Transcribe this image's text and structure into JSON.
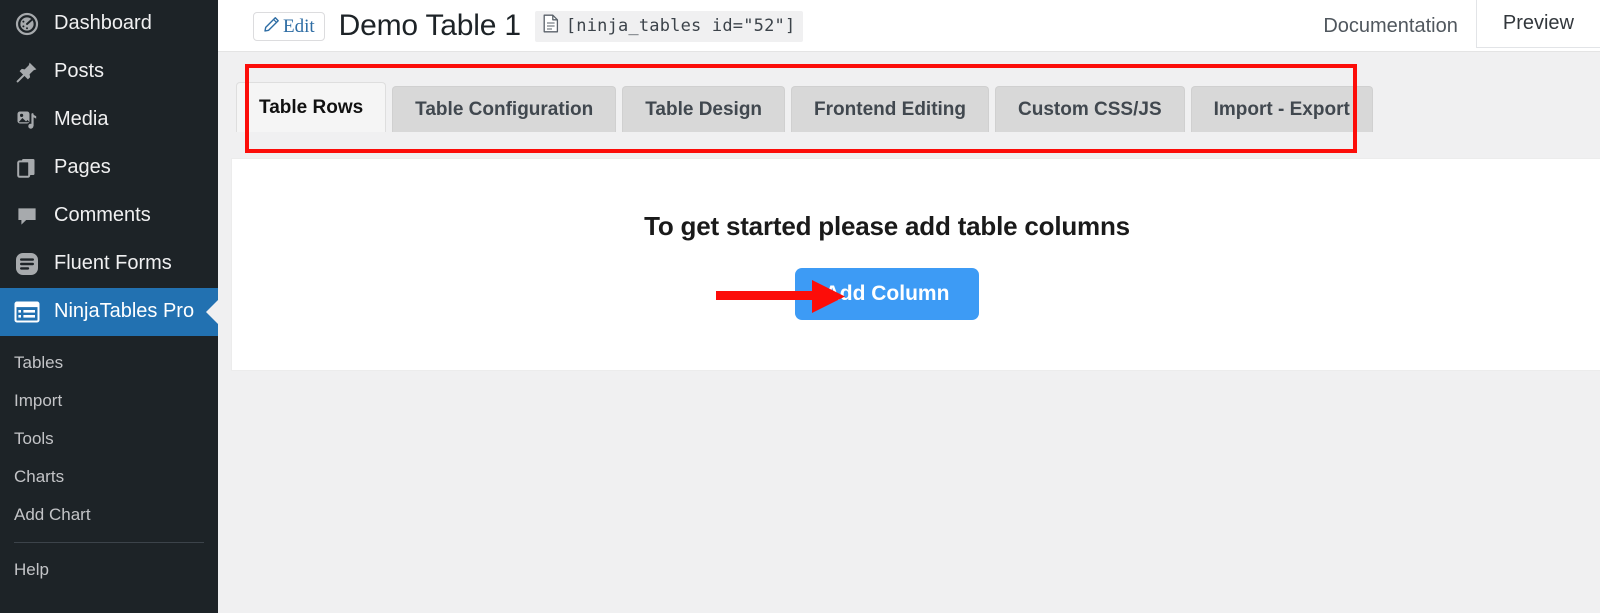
{
  "sidebar": {
    "items": [
      {
        "label": "Dashboard",
        "icon": "dashboard-icon"
      },
      {
        "label": "Posts",
        "icon": "pin-icon"
      },
      {
        "label": "Media",
        "icon": "media-icon"
      },
      {
        "label": "Pages",
        "icon": "pages-icon"
      },
      {
        "label": "Comments",
        "icon": "comment-icon"
      },
      {
        "label": "Fluent Forms",
        "icon": "fluent-forms-icon"
      },
      {
        "label": "NinjaTables Pro",
        "icon": "ninjatables-icon",
        "active": true
      }
    ],
    "submenu": [
      {
        "label": "Tables"
      },
      {
        "label": "Import"
      },
      {
        "label": "Tools"
      },
      {
        "label": "Charts"
      },
      {
        "label": "Add Chart"
      },
      {
        "label": "Help"
      }
    ],
    "active_bg": "#2271b1"
  },
  "header": {
    "edit_label": "Edit",
    "title": "Demo Table 1",
    "shortcode": "[ninja_tables id=\"52\"]",
    "documentation_label": "Documentation",
    "preview_label": "Preview"
  },
  "tabs": [
    {
      "label": "Table Rows",
      "active": true
    },
    {
      "label": "Table Configuration",
      "active": false
    },
    {
      "label": "Table Design",
      "active": false
    },
    {
      "label": "Frontend Editing",
      "active": false
    },
    {
      "label": "Custom CSS/JS",
      "active": false
    },
    {
      "label": "Import - Export",
      "active": false
    }
  ],
  "main": {
    "empty_heading": "To get started please add table columns",
    "add_column_label": "Add Column",
    "button_color": "#3d9bf5"
  },
  "annotations": {
    "color": "#fc0d09",
    "rect_target": "tab-strip",
    "arrow_target": "add-column-button"
  }
}
